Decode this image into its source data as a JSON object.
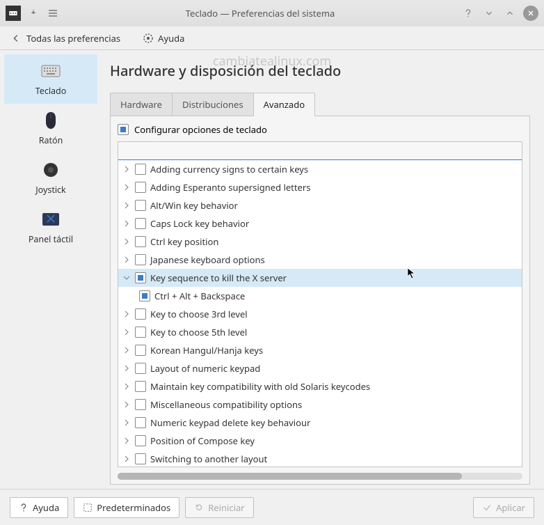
{
  "window": {
    "title": "Teclado — Preferencias del sistema"
  },
  "toolbar": {
    "back_label": "Todas las preferencias",
    "help_label": "Ayuda"
  },
  "watermark": "cambiatealinux.com",
  "sidebar": {
    "items": [
      {
        "label": "Teclado"
      },
      {
        "label": "Ratón"
      },
      {
        "label": "Joystick"
      },
      {
        "label": "Panel táctil"
      }
    ]
  },
  "main": {
    "heading": "Hardware y disposición del teclado",
    "tabs": [
      {
        "label": "Hardware"
      },
      {
        "label": "Distribuciones"
      },
      {
        "label": "Avanzado"
      }
    ],
    "configure_label": "Configurar opciones de teclado",
    "tree": [
      {
        "label": "Adding currency signs to certain keys",
        "checked": false,
        "expanded": false
      },
      {
        "label": "Adding Esperanto supersigned letters",
        "checked": false,
        "expanded": false
      },
      {
        "label": "Alt/Win key behavior",
        "checked": false,
        "expanded": false
      },
      {
        "label": "Caps Lock key behavior",
        "checked": false,
        "expanded": false
      },
      {
        "label": "Ctrl key position",
        "checked": false,
        "expanded": false
      },
      {
        "label": "Japanese keyboard options",
        "checked": false,
        "expanded": false
      },
      {
        "label": "Key sequence to kill the X server",
        "checked": "partial",
        "expanded": true,
        "selected": true,
        "children": [
          {
            "label": "Ctrl + Alt + Backspace",
            "checked": true
          }
        ]
      },
      {
        "label": "Key to choose 3rd level",
        "checked": false,
        "expanded": false
      },
      {
        "label": "Key to choose 5th level",
        "checked": false,
        "expanded": false
      },
      {
        "label": "Korean Hangul/Hanja keys",
        "checked": false,
        "expanded": false
      },
      {
        "label": "Layout of numeric keypad",
        "checked": false,
        "expanded": false
      },
      {
        "label": "Maintain key compatibility with old Solaris keycodes",
        "checked": false,
        "expanded": false
      },
      {
        "label": "Miscellaneous compatibility options",
        "checked": false,
        "expanded": false
      },
      {
        "label": "Numeric keypad delete key behaviour",
        "checked": false,
        "expanded": false
      },
      {
        "label": "Position of Compose key",
        "checked": false,
        "expanded": false
      },
      {
        "label": "Switching to another layout",
        "checked": false,
        "expanded": false
      }
    ]
  },
  "footer": {
    "help": "Ayuda",
    "defaults": "Predeterminados",
    "reset": "Reiniciar",
    "apply": "Aplicar"
  }
}
